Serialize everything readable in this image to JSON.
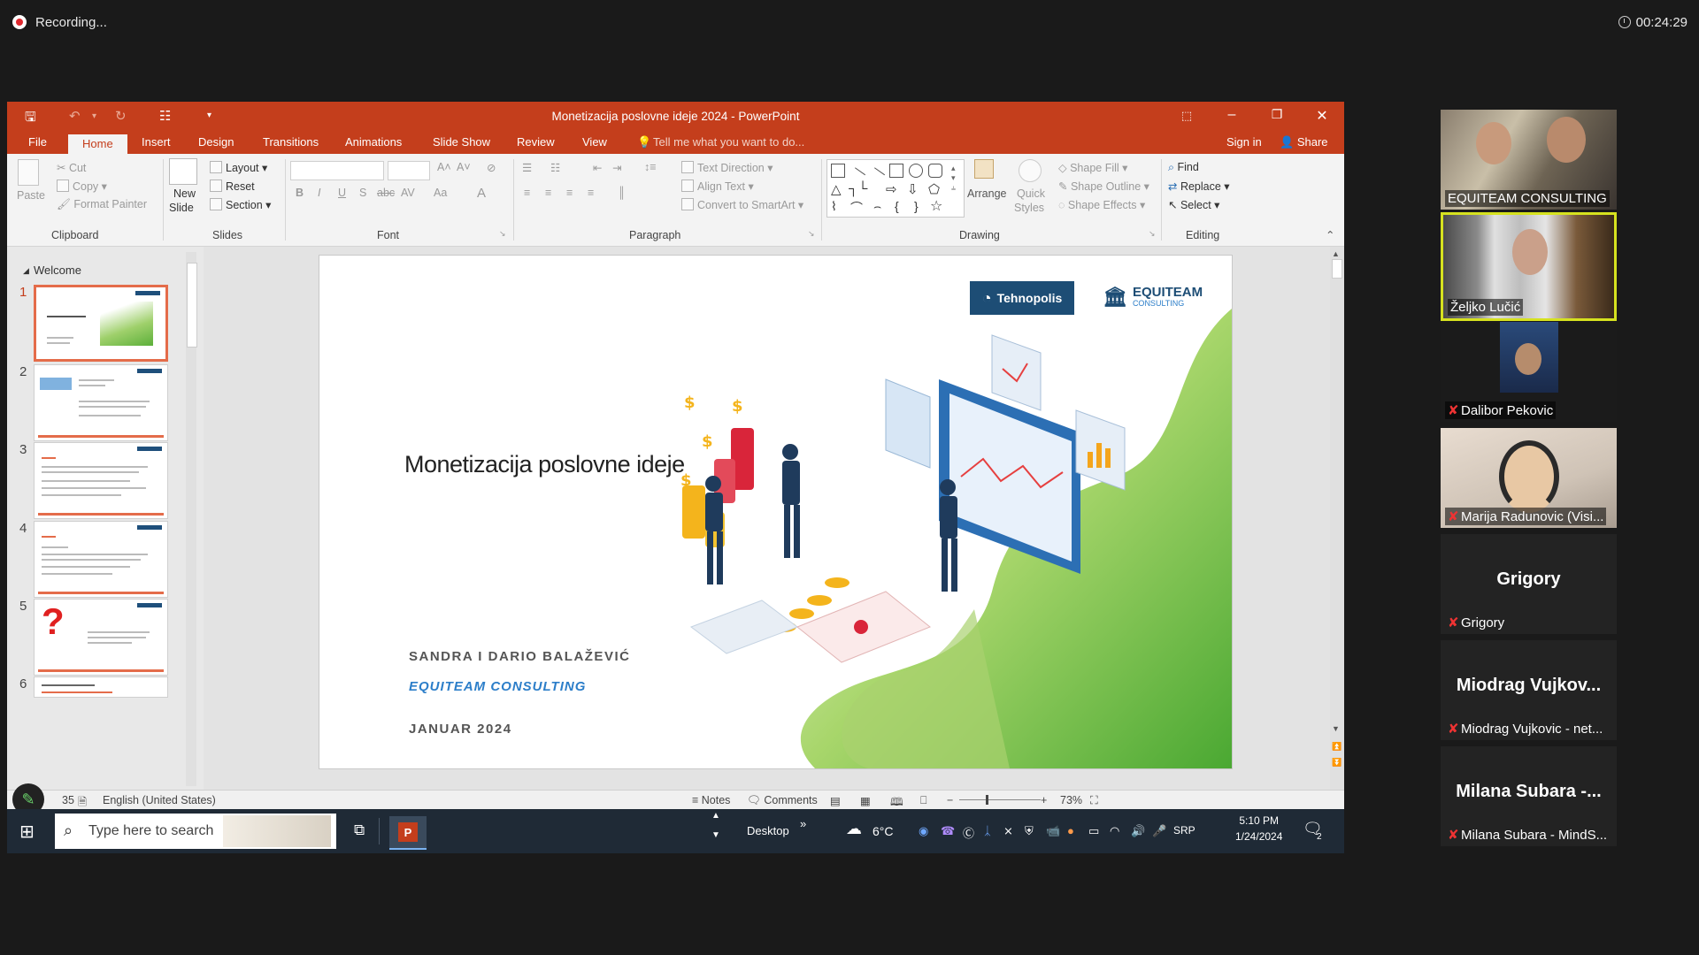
{
  "meeting": {
    "recording_label": "Recording...",
    "timer": "00:24:29"
  },
  "window": {
    "title": "Monetizacija poslovne ideje 2024 - PowerPoint"
  },
  "tabs": [
    "File",
    "Home",
    "Insert",
    "Design",
    "Transitions",
    "Animations",
    "Slide Show",
    "Review",
    "View"
  ],
  "tell_me": "Tell me what you want to do...",
  "account": {
    "sign_in": "Sign in",
    "share": "Share"
  },
  "ribbon": {
    "clipboard": {
      "paste": "Paste",
      "cut": "Cut",
      "copy": "Copy",
      "format_painter": "Format Painter",
      "label": "Clipboard"
    },
    "slides": {
      "new_slide_1": "New",
      "new_slide_2": "Slide",
      "layout": "Layout",
      "reset": "Reset",
      "section": "Section",
      "label": "Slides"
    },
    "font": {
      "label": "Font",
      "bold": "B",
      "italic": "I",
      "underline": "U",
      "shadow": "S",
      "strike": "abc",
      "spacing": "AV",
      "case": "Aa"
    },
    "paragraph": {
      "text_direction": "Text Direction",
      "align_text": "Align Text",
      "convert_smartart": "Convert to SmartArt",
      "label": "Paragraph"
    },
    "drawing": {
      "arrange": "Arrange",
      "quick_styles_1": "Quick",
      "quick_styles_2": "Styles",
      "shape_fill": "Shape Fill",
      "shape_outline": "Shape Outline",
      "shape_effects": "Shape Effects",
      "label": "Drawing"
    },
    "editing": {
      "find": "Find",
      "replace": "Replace",
      "select": "Select",
      "label": "Editing"
    }
  },
  "slide_panel": {
    "section": "Welcome",
    "numbers": [
      "1",
      "2",
      "3",
      "4",
      "5",
      "6"
    ]
  },
  "slide": {
    "title": "Monetizacija poslovne ideje",
    "authors": "SANDRA  I DARIO BALAŽEVIĆ",
    "company": "EQUITEAM CONSULTING",
    "date": "JANUAR 2024",
    "logo_tech": "Tehnopolis",
    "logo_eq_1": "EQUITEAM",
    "logo_eq_2": "CONSULTING"
  },
  "statusbar": {
    "slide_count": "35",
    "language": "English (United States)",
    "notes": "Notes",
    "comments": "Comments",
    "zoom": "73%"
  },
  "taskbar": {
    "search_placeholder": "Type here to search",
    "desktop": "Desktop",
    "weather": "6°C",
    "lang": "SRP",
    "time": "5:10 PM",
    "date": "1/24/2024",
    "notif_count": "2"
  },
  "participants": [
    {
      "name": "EQUITEAM CONSULTING",
      "muted": false,
      "video": true
    },
    {
      "name": "Željko Lučić",
      "muted": false,
      "video": true,
      "active": true
    },
    {
      "name": "Dalibor Pekovic",
      "muted": true,
      "video": true
    },
    {
      "name": "Marija Radunovic (Visi...",
      "muted": true,
      "video": true
    },
    {
      "name": "Grigory",
      "big": "Grigory",
      "muted": true,
      "video": false
    },
    {
      "name": "Miodrag Vujkovic - net...",
      "big": "Miodrag Vujkov...",
      "muted": true,
      "video": false
    },
    {
      "name": "Milana Subara - MindS...",
      "big": "Milana Subara -...",
      "muted": true,
      "video": false
    }
  ],
  "colors": {
    "accent": "#c43e1c",
    "slide_blue": "#2c7ec9",
    "active_speaker": "#d6e21f"
  }
}
